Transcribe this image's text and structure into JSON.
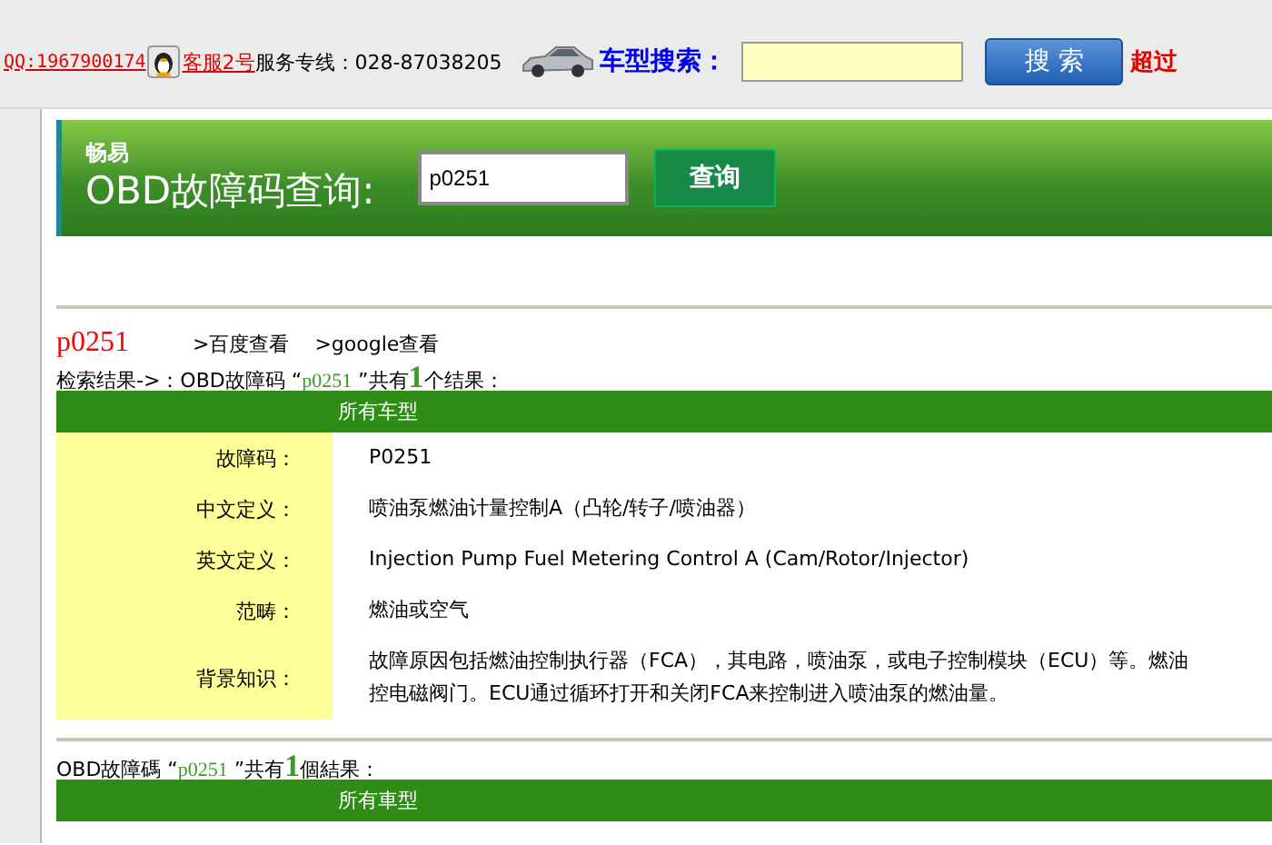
{
  "top_bar": {
    "qq_link": "QQ:1967900174",
    "service_link": "客服2号",
    "hotline": "服务专线：028-87038205",
    "search_label": "车型搜索：",
    "search_button": "搜 索",
    "cut_label": "超过"
  },
  "banner": {
    "brand": "畅易",
    "title": "OBD故障码查询:",
    "query": "p0251",
    "button": "查询"
  },
  "result_head": {
    "code": "p0251",
    "links": [
      ">百度查看",
      ">google查看"
    ]
  },
  "sections": [
    {
      "lead": "检索结果->：OBD故障码 “",
      "code": "p0251",
      "mid": " ”共有",
      "count": "1",
      "tail": "个结果：",
      "header": "所有车型",
      "rows": [
        {
          "label": "故障码：",
          "value": "P0251"
        },
        {
          "label": "中文定义：",
          "value": "喷油泵燃油计量控制A（凸轮/转子/喷油器）"
        },
        {
          "label": "英文定义：",
          "value": "Injection Pump Fuel Metering Control A (Cam/Rotor/Injector)"
        },
        {
          "label": "范畴：",
          "value": "燃油或空气"
        },
        {
          "label": "背景知识：",
          "lines": [
            "故障原因包括燃油控制执行器（FCA），其电路，喷油泵，或电子控制模块（ECU）等。燃油",
            "控电磁阀门。ECU通过循环打开和关闭FCA来控制进入喷油泵的燃油量。"
          ]
        }
      ]
    },
    {
      "lead": "OBD故障碼 “",
      "code": "p0251",
      "mid": " ”共有",
      "count": "1",
      "tail": "個結果：",
      "header": "所有車型"
    }
  ]
}
